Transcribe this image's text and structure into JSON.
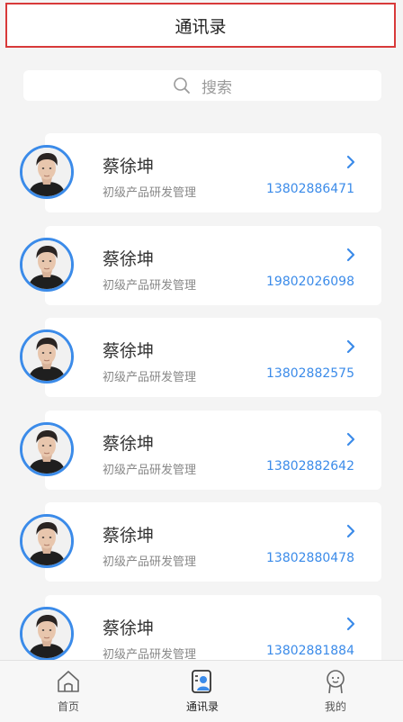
{
  "header": {
    "title": "通讯录"
  },
  "search": {
    "placeholder": "搜索"
  },
  "contacts": [
    {
      "name": "蔡徐坤",
      "title": "初级产品研发管理",
      "phone": "13802886471"
    },
    {
      "name": "蔡徐坤",
      "title": "初级产品研发管理",
      "phone": "19802026098"
    },
    {
      "name": "蔡徐坤",
      "title": "初级产品研发管理",
      "phone": "13802882575"
    },
    {
      "name": "蔡徐坤",
      "title": "初级产品研发管理",
      "phone": "13802882642"
    },
    {
      "name": "蔡徐坤",
      "title": "初级产品研发管理",
      "phone": "13802880478"
    },
    {
      "name": "蔡徐坤",
      "title": "初级产品研发管理",
      "phone": "13802881884"
    }
  ],
  "tabbar": {
    "items": [
      {
        "label": "首页",
        "icon": "home-icon",
        "active": false
      },
      {
        "label": "通讯录",
        "icon": "contacts-icon",
        "active": true
      },
      {
        "label": "我的",
        "icon": "profile-face-icon",
        "active": false
      }
    ]
  },
  "colors": {
    "accent": "#3b8be9",
    "header_border": "#d83a3a",
    "background": "#f4f4f4"
  }
}
